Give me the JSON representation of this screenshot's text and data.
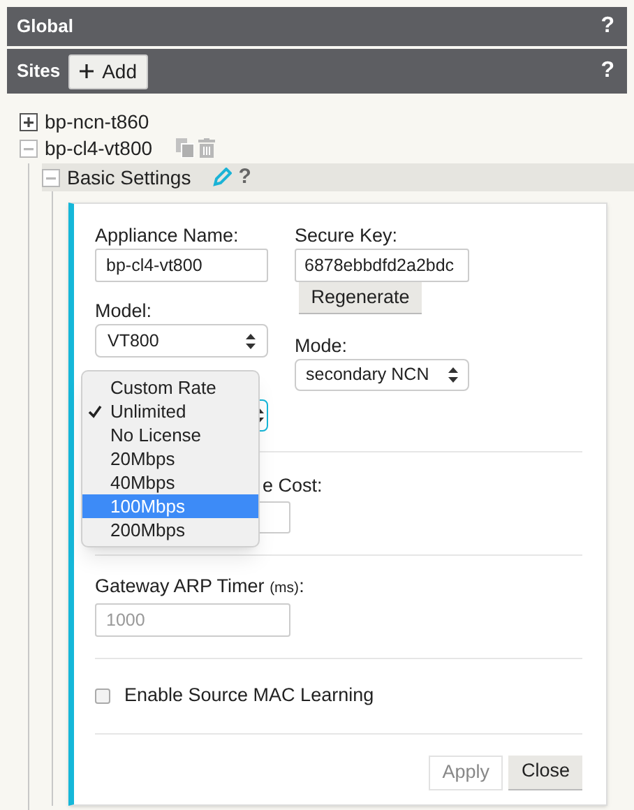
{
  "global_bar": {
    "title": "Global",
    "help": "?"
  },
  "sites_bar": {
    "title": "Sites",
    "add_button": "Add",
    "help": "?"
  },
  "tree": [
    {
      "label": "bp-ncn-t860",
      "expanded": false,
      "show_actions": false
    },
    {
      "label": "bp-cl4-vt800",
      "expanded": true,
      "show_actions": true,
      "children": [
        {
          "label": "Basic Settings",
          "expanded": true,
          "help": "?"
        }
      ]
    }
  ],
  "form": {
    "appliance_name": {
      "label": "Appliance Name:",
      "value": "bp-cl4-vt800"
    },
    "secure_key": {
      "label": "Secure Key:",
      "value": "6878ebbdfd2a2bdc",
      "button": "Regenerate"
    },
    "model": {
      "label": "Model:",
      "value": "VT800"
    },
    "mode": {
      "label": "Mode:",
      "value": "secondary NCN"
    },
    "cost": {
      "label": "e Cost:"
    },
    "gateway_arp_timer": {
      "label": "Gateway ARP Timer",
      "unit": "(ms)",
      "suffix": ":",
      "placeholder": "1000"
    },
    "source_mac_learning": {
      "label": "Enable Source MAC Learning",
      "checked": false
    },
    "buttons": [
      {
        "label": "Apply",
        "disabled": true
      },
      {
        "label": "Close",
        "disabled": false
      }
    ]
  },
  "dropdown": [
    {
      "label": "Custom Rate",
      "checked": false,
      "selected": false
    },
    {
      "label": "Unlimited",
      "checked": true,
      "selected": false
    },
    {
      "label": "No License",
      "checked": false,
      "selected": false
    },
    {
      "label": "20Mbps",
      "checked": false,
      "selected": false
    },
    {
      "label": "40Mbps",
      "checked": false,
      "selected": false
    },
    {
      "label": "100Mbps",
      "checked": false,
      "selected": true
    },
    {
      "label": "200Mbps",
      "checked": false,
      "selected": false
    }
  ]
}
